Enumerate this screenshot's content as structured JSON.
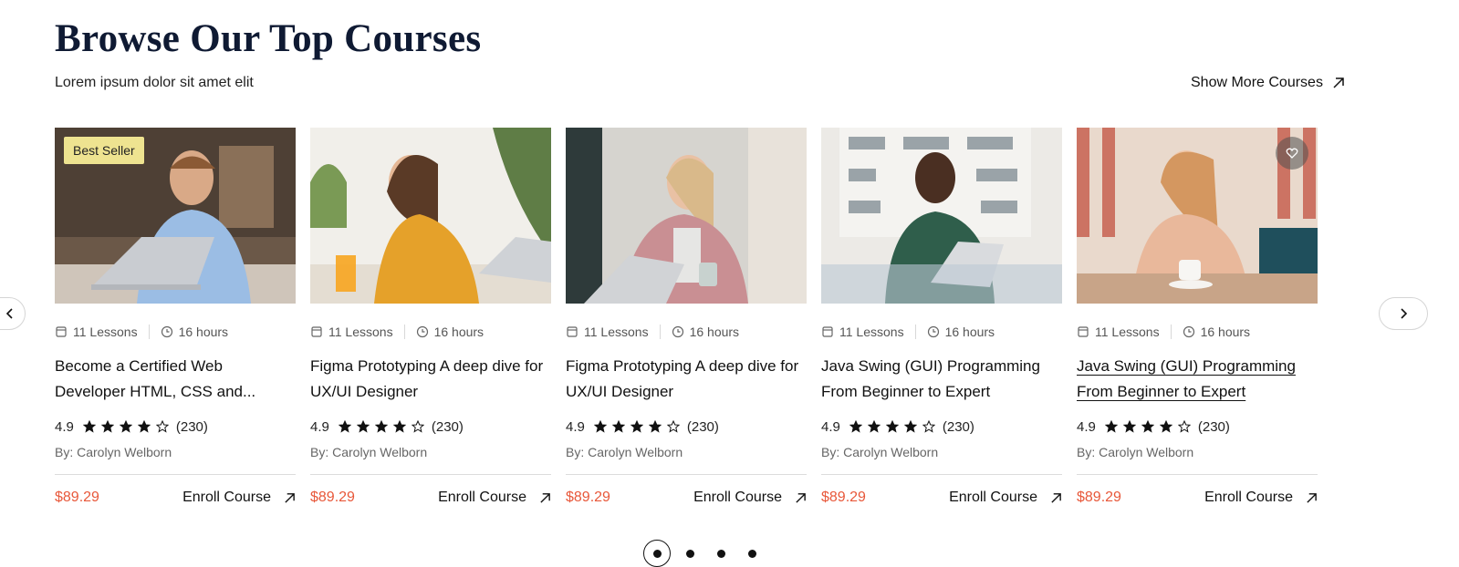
{
  "header": {
    "title": "Browse Our Top Courses",
    "subtitle": "Lorem ipsum dolor sit amet elit",
    "show_more": "Show More Courses",
    "show_more_icon": "arrow-up-right-icon"
  },
  "carousel": {
    "prev_icon": "chevron-left-icon",
    "next_icon": "chevron-right-icon",
    "pages": 4,
    "active_page": 1
  },
  "colors": {
    "price": "#e8583a",
    "badge_bg": "#eee390",
    "title": "#0f1a33"
  },
  "courses": [
    {
      "badge": "Best Seller",
      "lessons": "11 Lessons",
      "hours": "16 hours",
      "title": "Become a Certified Web Developer HTML, CSS and...",
      "rating": "4.9",
      "stars": 4,
      "reviews": "(230)",
      "author": "By: Carolyn Welborn",
      "price": "$89.29",
      "enroll": "Enroll Course"
    },
    {
      "lessons": "11 Lessons",
      "hours": "16 hours",
      "title": "Figma Prototyping A deep dive for UX/UI Designer",
      "rating": "4.9",
      "stars": 4,
      "reviews": "(230)",
      "author": "By: Carolyn Welborn",
      "price": "$89.29",
      "enroll": "Enroll Course"
    },
    {
      "lessons": "11 Lessons",
      "hours": "16 hours",
      "title": "Figma Prototyping A deep dive for UX/UI Designer",
      "rating": "4.9",
      "stars": 4,
      "reviews": "(230)",
      "author": "By: Carolyn Welborn",
      "price": "$89.29",
      "enroll": "Enroll Course"
    },
    {
      "lessons": "11 Lessons",
      "hours": "16 hours",
      "title": "Java Swing (GUI) Programming From Beginner to Expert",
      "rating": "4.9",
      "stars": 4,
      "reviews": "(230)",
      "author": "By: Carolyn Welborn",
      "price": "$89.29",
      "enroll": "Enroll Course"
    },
    {
      "lessons": "11 Lessons",
      "hours": "16 hours",
      "title": "Java Swing (GUI) Programming From Beginner to Expert",
      "rating": "4.9",
      "stars": 4,
      "reviews": "(230)",
      "author": "By: Carolyn Welborn",
      "price": "$89.29",
      "enroll": "Enroll Course",
      "wishlist_icon": "heart-icon"
    }
  ]
}
